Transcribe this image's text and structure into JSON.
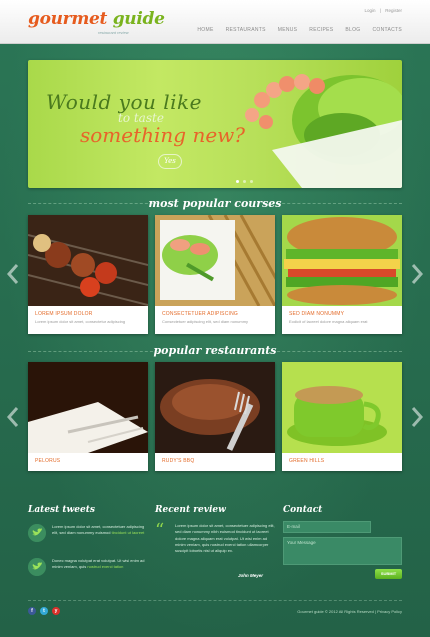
{
  "header": {
    "logo_part1": "gourmet ",
    "logo_part2": "guide",
    "logo_tagline": "restaurant review",
    "top_links": [
      "Login",
      "|",
      "Register"
    ],
    "nav": [
      "HOME",
      "RESTAURANTS",
      "MENUS",
      "RECIPES",
      "BLOG",
      "CONTACTS"
    ]
  },
  "hero": {
    "line1": "Would you like",
    "line2": "to taste",
    "line3": "something new?",
    "cta": "Yes"
  },
  "courses": {
    "title": "most popular courses",
    "items": [
      {
        "title": "LOREM IPSUM DOLOR",
        "text": "Lorem ipsum dolor sit amet, consectetur adipiscing"
      },
      {
        "title": "CONSECTETUER ADIPISCING",
        "text": "Consectetuer adipiscing elit, sed diam nonummy"
      },
      {
        "title": "SED DIAM NONUMMY",
        "text": "Eodicit of laoreet dolore magna aliquam erat"
      }
    ]
  },
  "restaurants": {
    "title": "popular restaurants",
    "items": [
      {
        "title": "PELORUS"
      },
      {
        "title": "RUDY'S BBQ"
      },
      {
        "title": "GREEN HILLS"
      }
    ]
  },
  "tweets": {
    "title": "Latest tweets",
    "items": [
      {
        "text": "Lorem ipsum dolor sit amet, consectetuer adipiscing elit, sed diam nonummy euismod ",
        "link": "tincidunt ut laoreet"
      },
      {
        "text": "Donec magna volutpat erat volutpat. Ut wisi enim ad minim veniam, quis ",
        "link": "nostrud exerci tation"
      }
    ]
  },
  "review": {
    "title": "Recent review",
    "quote_mark": "“",
    "text": "Lorem ipsum dolor sit amet, consectetuer adipiscing elit, sed diam nonummy nibh euismod tincidunt ut laoreet dolore magna aliquam erat volutpat. Ut wisi enim ad minim veniam, quis nostrud exerci tation ullamcorper suscipit lobortis nisl ut aliquip ex.",
    "author": "John Meyer"
  },
  "contact": {
    "title": "Contact",
    "email_placeholder": "E-mail",
    "message_placeholder": "Your Message",
    "submit_label": "SUBMIT"
  },
  "footer": {
    "social": [
      "f",
      "t",
      "y"
    ],
    "copyright": "Gourmet guide © 2012 All Rights Reserved  |  Privacy Policy"
  },
  "colors": {
    "background": "#2b7656",
    "accent_orange": "#e36b2a",
    "accent_green": "#8fd64c"
  },
  "icons": [
    "arrow-left-icon",
    "arrow-right-icon",
    "twitter-bird-icon",
    "facebook-icon",
    "twitter-icon",
    "youtube-icon"
  ]
}
